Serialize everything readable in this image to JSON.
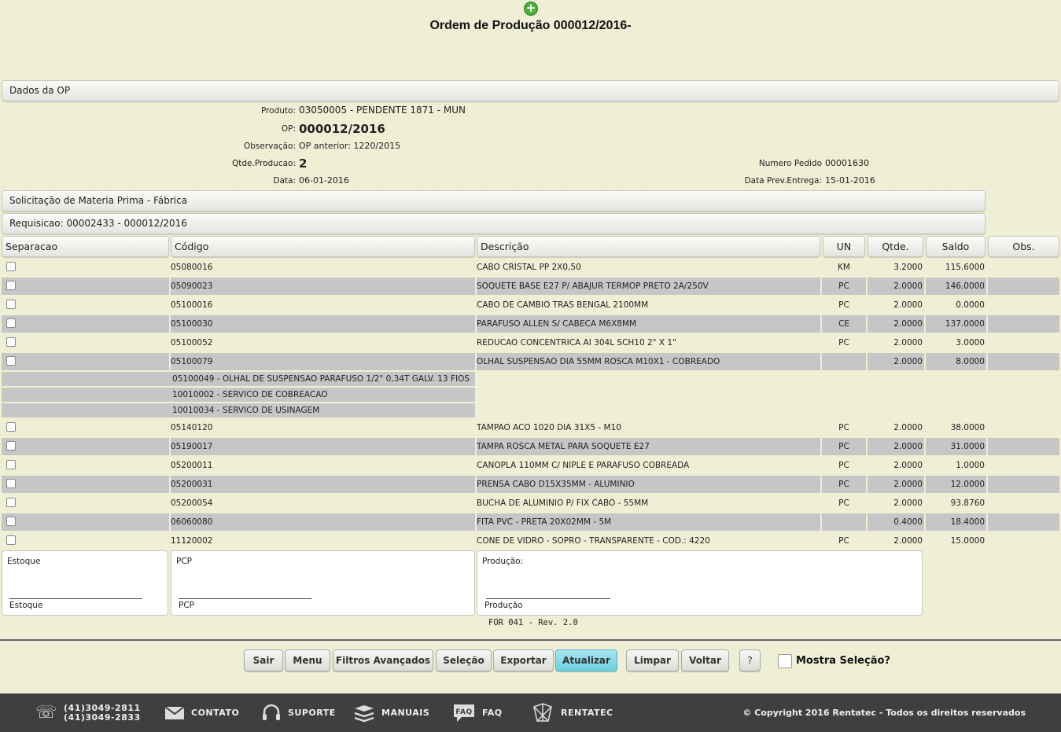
{
  "title": "Ordem de Produção 000012/2016-",
  "sections": {
    "dados": "Dados da OP",
    "solicitacao": "Solicitação de Materia Prima - Fábrica",
    "requisicao": "Requisicao: 00002433 - 000012/2016"
  },
  "op": {
    "produto_label": "Produto:",
    "produto": "03050005 - PENDENTE 1871 - MUN",
    "op_label": "OP:",
    "op": "000012/2016",
    "obs_label": "Observação:",
    "obs": "OP anterior: 1220/2015",
    "qtde_label": "Qtde.Producao:",
    "qtde": "2",
    "data_label": "Data:",
    "data": "06-01-2016",
    "pedido_label": "Numero Pedido",
    "pedido": "00001630",
    "entrega_label": "Data Prev.Entrega:",
    "entrega": "15-01-2016"
  },
  "table": {
    "headers": [
      "Separacao",
      "Código",
      "Descrição",
      "UN",
      "Qtde.",
      "Saldo",
      "Obs."
    ],
    "rows": [
      {
        "codigo": "05080016",
        "descricao": "CABO CRISTAL PP 2X0,50",
        "un": "KM",
        "qtde": "3.2000",
        "saldo": "115.6000"
      },
      {
        "codigo": "05090023",
        "descricao": "SOQUETE BASE E27 P/ ABAJUR TERMOP PRETO 2A/250V",
        "un": "PC",
        "qtde": "2.0000",
        "saldo": "146.0000"
      },
      {
        "codigo": "05100016",
        "descricao": "CABO DE CAMBIO TRAS BENGAL 2100MM",
        "un": "PC",
        "qtde": "2.0000",
        "saldo": "0.0000"
      },
      {
        "codigo": "05100030",
        "descricao": "PARAFUSO ALLEN S/ CABECA M6X8MM",
        "un": "CE",
        "qtde": "2.0000",
        "saldo": "137.0000"
      },
      {
        "codigo": "05100052",
        "descricao": "REDUCAO CONCENTRICA AI 304L SCH10 2\" X 1\"",
        "un": "PC",
        "qtde": "2.0000",
        "saldo": "3.0000"
      },
      {
        "codigo": "05100079",
        "descricao": "OLHAL SUSPENSAO DIA 55MM ROSCA M10X1 - COBREADO",
        "un": "",
        "qtde": "2.0000",
        "saldo": "8.0000"
      }
    ],
    "subrows": [
      "05100049 - OLHAL DE SUSPENSAO PARAFUSO 1/2\" 0,34T GALV. 13 FIOS",
      "10010002 - SERVICO DE COBREACAO",
      "10010034 - SERVICO DE USINAGEM"
    ],
    "rows2": [
      {
        "codigo": "05140120",
        "descricao": "TAMPAO ACO 1020 DIA 31X5 - M10",
        "un": "PC",
        "qtde": "2.0000",
        "saldo": "38.0000"
      },
      {
        "codigo": "05190017",
        "descricao": "TAMPA ROSCA METAL PARA SOQUETE E27",
        "un": "PC",
        "qtde": "2.0000",
        "saldo": "31.0000"
      },
      {
        "codigo": "05200011",
        "descricao": "CANOPLA 110MM C/ NIPLE E PARAFUSO COBREADA",
        "un": "PC",
        "qtde": "2.0000",
        "saldo": "1.0000"
      },
      {
        "codigo": "05200031",
        "descricao": "PRENSA CABO D15X35MM - ALUMINIO",
        "un": "PC",
        "qtde": "2.0000",
        "saldo": "12.0000"
      },
      {
        "codigo": "05200054",
        "descricao": "BUCHA DE ALUMINIO P/ FIX CABO - 55MM",
        "un": "PC",
        "qtde": "2.0000",
        "saldo": "93.8760"
      },
      {
        "codigo": "06060080",
        "descricao": "FITA PVC - PRETA 20X02MM - 5M",
        "un": "",
        "qtde": "0.4000",
        "saldo": "18.4000"
      },
      {
        "codigo": "11120002",
        "descricao": "CONE DE VIDRO - SOPRO - TRANSPARENTE - COD.: 4220",
        "un": "PC",
        "qtde": "2.0000",
        "saldo": "15.0000"
      }
    ]
  },
  "signatures": {
    "estoque": "Estoque",
    "pcp": "PCP",
    "producao_title": "Produção:",
    "producao": "Produção"
  },
  "revision": "FOR 041 - Rev. 2.0",
  "buttons": [
    "Sair",
    "Menu",
    "Filtros Avançados",
    "Seleção",
    "Exportar",
    "Atualizar",
    "Limpar",
    "Voltar",
    "?"
  ],
  "mostra_selecao": "Mostra Seleção?",
  "footer": {
    "phone1": "(41)3049-2811",
    "phone2": "(41)3049-2833",
    "contato": "CONTATO",
    "suporte": "SUPORTE",
    "manuais": "MANUAIS",
    "faq": "FAQ",
    "rentatec": "RENTATEC",
    "copyright": "© Copyright 2016 Rentatec - Todos os direitos reservados"
  },
  "colors": {
    "background": "#efefd5",
    "row_alt": "#c6c6c6",
    "active_button": "#6fcfe0",
    "footer": "#3f3f3f"
  }
}
